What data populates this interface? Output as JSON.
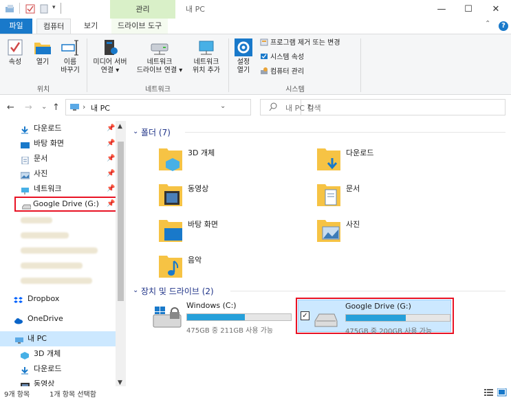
{
  "title": {
    "context_tab": "관리",
    "window_title": "내 PC"
  },
  "window_controls": {
    "minimize": "—",
    "maximize": "☐",
    "close": "✕"
  },
  "ribbon_tabs": {
    "file": "파일",
    "computer": "컴퓨터",
    "view": "보기",
    "drive_tools": "드라이브 도구",
    "help": "?",
    "collapse": "⌃"
  },
  "ribbon": {
    "location": {
      "properties": "속성",
      "open": "열기",
      "rename_line1": "이름",
      "rename_line2": "바꾸기",
      "label": "위치"
    },
    "network": {
      "media_line1": "미디어 서버",
      "media_line2": "연결 ▾",
      "map_line1": "네트워크",
      "map_line2": "드라이브 연결 ▾",
      "add_line1": "네트워크",
      "add_line2": "위치 추가",
      "label": "네트워크"
    },
    "system": {
      "settings_line1": "설정",
      "settings_line2": "열기",
      "uninstall": "프로그램 제거 또는 변경",
      "sys_props": "시스템 속성",
      "manage": "컴퓨터 관리",
      "label": "시스템"
    }
  },
  "nav": {
    "back": "←",
    "forward": "→",
    "recent": "⌄",
    "up": "↑",
    "path_sep": "›",
    "path": "내 PC",
    "dropdown": "⌄",
    "refresh": "↻",
    "search_placeholder": "내 PC 검색"
  },
  "navpane": {
    "quick_access": [
      {
        "label": "다운로드",
        "icon": "download-icon"
      },
      {
        "label": "바탕 화면",
        "icon": "desktop-icon"
      },
      {
        "label": "문서",
        "icon": "document-icon"
      },
      {
        "label": "사진",
        "icon": "picture-icon"
      },
      {
        "label": "네트워크",
        "icon": "network-icon"
      },
      {
        "label": "Google Drive (G:)",
        "icon": "drive-icon"
      }
    ],
    "pin_glyph": "📌",
    "dropbox": "Dropbox",
    "onedrive": "OneDrive",
    "this_pc": "내 PC",
    "this_pc_children": [
      {
        "label": "3D 개체"
      },
      {
        "label": "다운로드"
      },
      {
        "label": "동영상"
      }
    ]
  },
  "content": {
    "folders_header": "폴더 (7)",
    "folders": [
      {
        "name": "3D 개체",
        "icon": "3d-objects-icon"
      },
      {
        "name": "다운로드",
        "icon": "downloads-icon"
      },
      {
        "name": "동영상",
        "icon": "videos-icon"
      },
      {
        "name": "문서",
        "icon": "documents-icon"
      },
      {
        "name": "바탕 화면",
        "icon": "desktop-folder-icon"
      },
      {
        "name": "사진",
        "icon": "pictures-icon"
      },
      {
        "name": "음악",
        "icon": "music-icon"
      }
    ],
    "devices_header": "장치 및 드라이브 (2)",
    "drives": [
      {
        "name": "Windows  (C:)",
        "free": "475GB 중 211GB 사용 가능",
        "used_fraction": 0.556
      },
      {
        "name": "Google Drive (G:)",
        "free": "475GB 중 200GB 사용 가능",
        "used_fraction": 0.579
      }
    ],
    "checkbox_mark": "✓"
  },
  "status": {
    "item_count": "9개 항목",
    "selection": "1개 항목 선택함"
  },
  "colors": {
    "accent": "#1979ca",
    "highlight_border": "#e81123",
    "selection_bg": "#cce8ff",
    "drive_bar": "#26a0da"
  }
}
